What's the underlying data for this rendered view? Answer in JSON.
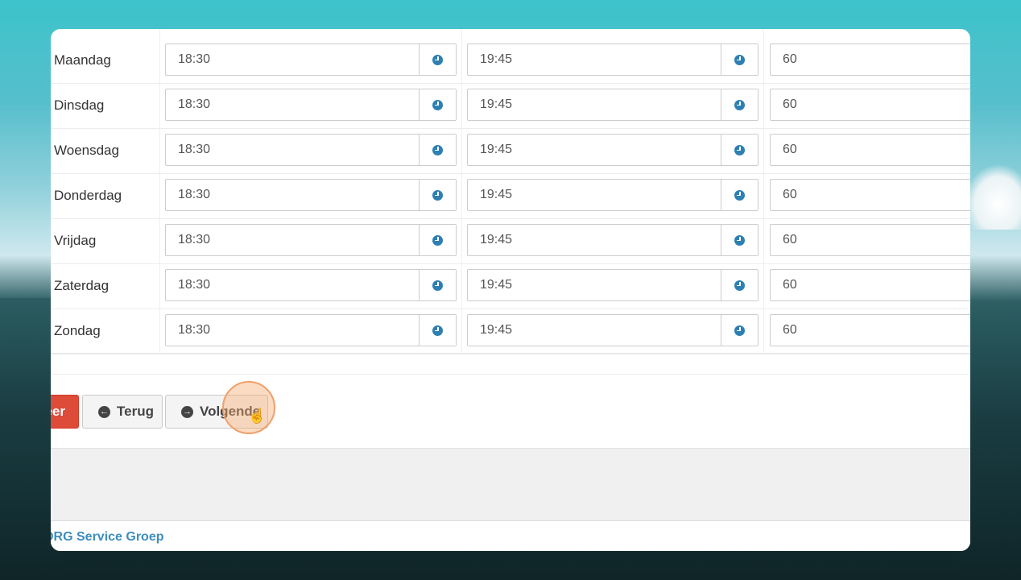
{
  "schedule": {
    "rows": [
      {
        "day": "Maandag",
        "start": "18:30",
        "end": "19:45",
        "duration": "60"
      },
      {
        "day": "Dinsdag",
        "start": "18:30",
        "end": "19:45",
        "duration": "60"
      },
      {
        "day": "Woensdag",
        "start": "18:30",
        "end": "19:45",
        "duration": "60"
      },
      {
        "day": "Donderdag",
        "start": "18:30",
        "end": "19:45",
        "duration": "60"
      },
      {
        "day": "Vrijdag",
        "start": "18:30",
        "end": "19:45",
        "duration": "60"
      },
      {
        "day": "Zaterdag",
        "start": "18:30",
        "end": "19:45",
        "duration": "60"
      },
      {
        "day": "Zondag",
        "start": "18:30",
        "end": "19:45",
        "duration": "60"
      }
    ],
    "time_icon": "clock-icon"
  },
  "buttons": {
    "danger_label": "eer",
    "back_label": "Terug",
    "back_icon": "arrow-circle-left-icon",
    "next_label": "Volgende",
    "next_icon": "arrow-circle-right-icon"
  },
  "footer": {
    "text": "DRG Service Groep"
  },
  "colors": {
    "danger": "#dd4b39",
    "link": "#3c8dbc",
    "icon": "#2e7fb2"
  }
}
